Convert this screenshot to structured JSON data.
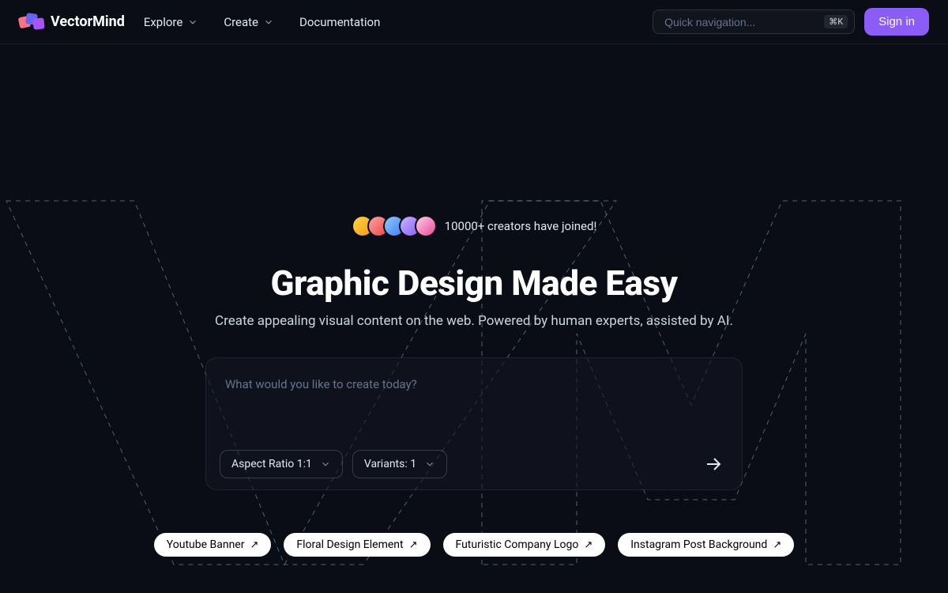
{
  "header": {
    "brand": "VectorMind",
    "nav": {
      "explore": "Explore",
      "create": "Create",
      "docs": "Documentation"
    },
    "search": {
      "placeholder": "Quick navigation...",
      "shortcut": "⌘K"
    },
    "signin": "Sign in"
  },
  "hero": {
    "creators_text": "10000+ creators have joined!",
    "title": "Graphic Design Made Easy",
    "subtitle": "Create appealing visual content on the web. Powered by human experts, assisted by AI.",
    "prompt_placeholder": "What would you like to create today?"
  },
  "controls": {
    "aspect_ratio": "Aspect Ratio 1:1",
    "variants": "Variants: 1"
  },
  "suggestions": [
    "Youtube Banner",
    "Floral Design Element",
    "Futuristic Company Logo",
    "Instagram Post Background"
  ]
}
